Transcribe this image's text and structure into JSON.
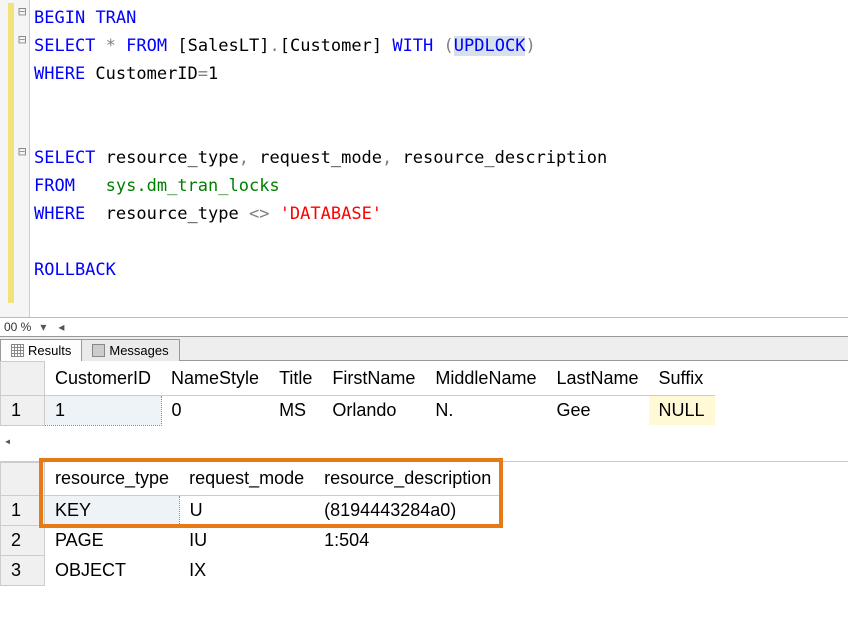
{
  "code": {
    "lines": [
      [
        {
          "t": "BEGIN",
          "c": "kw"
        },
        {
          "t": " ",
          "c": ""
        },
        {
          "t": "TRAN",
          "c": "kw"
        }
      ],
      [
        {
          "t": "SELECT",
          "c": "kw"
        },
        {
          "t": " ",
          "c": ""
        },
        {
          "t": "*",
          "c": "grey"
        },
        {
          "t": " ",
          "c": ""
        },
        {
          "t": "FROM",
          "c": "kw"
        },
        {
          "t": " [SalesLT]",
          "c": ""
        },
        {
          "t": ".",
          "c": "grey"
        },
        {
          "t": "[Customer] ",
          "c": ""
        },
        {
          "t": "WITH",
          "c": "kw"
        },
        {
          "t": " ",
          "c": ""
        },
        {
          "t": "(",
          "c": "grey"
        },
        {
          "t": "UPDLOCK",
          "c": "kw highlight"
        },
        {
          "t": ")",
          "c": "grey"
        }
      ],
      [
        {
          "t": "WHERE",
          "c": "kw"
        },
        {
          "t": " CustomerID",
          "c": ""
        },
        {
          "t": "=",
          "c": "grey"
        },
        {
          "t": "1",
          "c": ""
        }
      ],
      [
        {
          "t": "",
          "c": ""
        }
      ],
      [
        {
          "t": "",
          "c": ""
        }
      ],
      [
        {
          "t": "SELECT",
          "c": "kw"
        },
        {
          "t": " resource_type",
          "c": ""
        },
        {
          "t": ",",
          "c": "grey"
        },
        {
          "t": " request_mode",
          "c": ""
        },
        {
          "t": ",",
          "c": "grey"
        },
        {
          "t": " resource_description",
          "c": ""
        }
      ],
      [
        {
          "t": "FROM",
          "c": "kw"
        },
        {
          "t": "   ",
          "c": ""
        },
        {
          "t": "sys.dm_tran_locks",
          "c": "func"
        }
      ],
      [
        {
          "t": "WHERE",
          "c": "kw"
        },
        {
          "t": "  resource_type ",
          "c": ""
        },
        {
          "t": "<>",
          "c": "grey"
        },
        {
          "t": " ",
          "c": ""
        },
        {
          "t": "'DATABASE'",
          "c": "str"
        }
      ],
      [
        {
          "t": "",
          "c": ""
        }
      ],
      [
        {
          "t": "ROLLBACK",
          "c": "kw"
        }
      ]
    ]
  },
  "zoom": {
    "pct": "00 %"
  },
  "tabs": {
    "results": "Results",
    "messages": "Messages"
  },
  "grid1": {
    "headers": [
      "CustomerID",
      "NameStyle",
      "Title",
      "FirstName",
      "MiddleName",
      "LastName",
      "Suffix"
    ],
    "rows": [
      {
        "n": "1",
        "cells": [
          "1",
          "0",
          "MS",
          "Orlando",
          "N.",
          "Gee",
          "NULL"
        ],
        "sel_col": 0,
        "null_col": 6
      }
    ]
  },
  "grid2": {
    "headers": [
      "resource_type",
      "request_mode",
      "resource_description"
    ],
    "rows": [
      {
        "n": "1",
        "cells": [
          "KEY",
          "U",
          "(8194443284a0)"
        ],
        "sel_col": 0
      },
      {
        "n": "2",
        "cells": [
          "PAGE",
          "IU",
          "1:504"
        ]
      },
      {
        "n": "3",
        "cells": [
          "OBJECT",
          "IX",
          ""
        ]
      }
    ]
  }
}
